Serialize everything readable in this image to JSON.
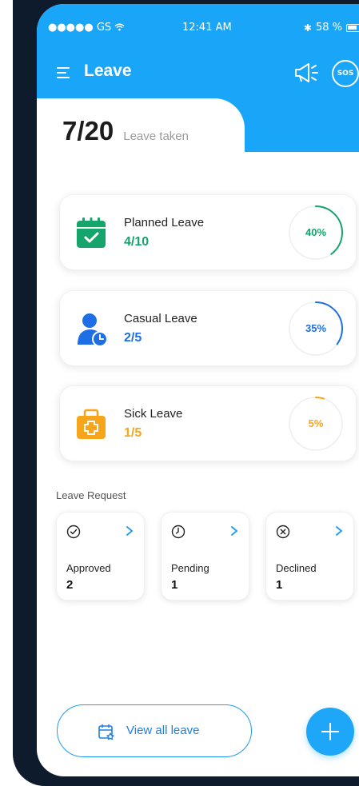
{
  "status_bar": {
    "carrier": "●●●●● GS",
    "time": "12:41 AM",
    "battery": "58 %"
  },
  "nav": {
    "title": "Leave",
    "sos_label": "SOS"
  },
  "summary": {
    "count": "7/20",
    "label": "Leave taken"
  },
  "leave_types": [
    {
      "title": "Planned Leave",
      "value": "4/10",
      "percent_label": "40%",
      "percent": 0.4,
      "color": "#14a46c",
      "icon": "calendar-check-icon"
    },
    {
      "title": "Casual Leave",
      "value": "2/5",
      "percent_label": "35%",
      "percent": 0.35,
      "color": "#1e6ee6",
      "icon": "person-clock-icon"
    },
    {
      "title": "Sick Leave",
      "value": "1/5",
      "percent_label": "5%",
      "percent": 0.05,
      "color": "#f7a51b",
      "icon": "medical-kit-icon"
    }
  ],
  "requests": {
    "section_title": "Leave Request",
    "items": [
      {
        "label": "Approved",
        "count": "2",
        "icon": "check-circle-icon"
      },
      {
        "label": "Pending",
        "count": "1",
        "icon": "clock-icon"
      },
      {
        "label": "Declined",
        "count": "1",
        "icon": "x-circle-icon"
      }
    ]
  },
  "footer": {
    "view_all_label": "View all leave"
  },
  "colors": {
    "accent": "#19a6f8",
    "link": "#1d7fe0"
  }
}
